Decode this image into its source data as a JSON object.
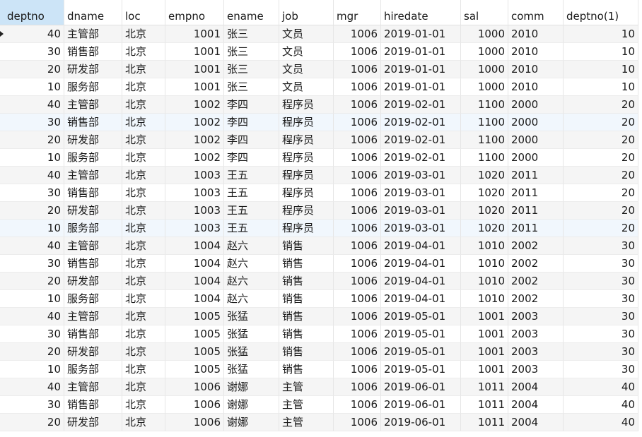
{
  "columns": [
    "deptno",
    "dname",
    "loc",
    "empno",
    "ename",
    "job",
    "mgr",
    "hiredate",
    "sal",
    "comm",
    "deptno(1)"
  ],
  "rows": [
    [
      "40",
      "主管部",
      "北京",
      "1001",
      "张三",
      "文员",
      "1006",
      "2019-01-01",
      "1000",
      "2010",
      "10"
    ],
    [
      "30",
      "销售部",
      "北京",
      "1001",
      "张三",
      "文员",
      "1006",
      "2019-01-01",
      "1000",
      "2010",
      "10"
    ],
    [
      "20",
      "研发部",
      "北京",
      "1001",
      "张三",
      "文员",
      "1006",
      "2019-01-01",
      "1000",
      "2010",
      "10"
    ],
    [
      "10",
      "服务部",
      "北京",
      "1001",
      "张三",
      "文员",
      "1006",
      "2019-01-01",
      "1000",
      "2010",
      "10"
    ],
    [
      "40",
      "主管部",
      "北京",
      "1002",
      "李四",
      "程序员",
      "1006",
      "2019-02-01",
      "1100",
      "2000",
      "20"
    ],
    [
      "30",
      "销售部",
      "北京",
      "1002",
      "李四",
      "程序员",
      "1006",
      "2019-02-01",
      "1100",
      "2000",
      "20"
    ],
    [
      "20",
      "研发部",
      "北京",
      "1002",
      "李四",
      "程序员",
      "1006",
      "2019-02-01",
      "1100",
      "2000",
      "20"
    ],
    [
      "10",
      "服务部",
      "北京",
      "1002",
      "李四",
      "程序员",
      "1006",
      "2019-02-01",
      "1100",
      "2000",
      "20"
    ],
    [
      "40",
      "主管部",
      "北京",
      "1003",
      "王五",
      "程序员",
      "1006",
      "2019-03-01",
      "1020",
      "2011",
      "20"
    ],
    [
      "30",
      "销售部",
      "北京",
      "1003",
      "王五",
      "程序员",
      "1006",
      "2019-03-01",
      "1020",
      "2011",
      "20"
    ],
    [
      "20",
      "研发部",
      "北京",
      "1003",
      "王五",
      "程序员",
      "1006",
      "2019-03-01",
      "1020",
      "2011",
      "20"
    ],
    [
      "10",
      "服务部",
      "北京",
      "1003",
      "王五",
      "程序员",
      "1006",
      "2019-03-01",
      "1020",
      "2011",
      "20"
    ],
    [
      "40",
      "主管部",
      "北京",
      "1004",
      "赵六",
      "销售",
      "1006",
      "2019-04-01",
      "1010",
      "2002",
      "30"
    ],
    [
      "30",
      "销售部",
      "北京",
      "1004",
      "赵六",
      "销售",
      "1006",
      "2019-04-01",
      "1010",
      "2002",
      "30"
    ],
    [
      "20",
      "研发部",
      "北京",
      "1004",
      "赵六",
      "销售",
      "1006",
      "2019-04-01",
      "1010",
      "2002",
      "30"
    ],
    [
      "10",
      "服务部",
      "北京",
      "1004",
      "赵六",
      "销售",
      "1006",
      "2019-04-01",
      "1010",
      "2002",
      "30"
    ],
    [
      "40",
      "主管部",
      "北京",
      "1005",
      "张猛",
      "销售",
      "1006",
      "2019-05-01",
      "1001",
      "2003",
      "30"
    ],
    [
      "30",
      "销售部",
      "北京",
      "1005",
      "张猛",
      "销售",
      "1006",
      "2019-05-01",
      "1001",
      "2003",
      "30"
    ],
    [
      "20",
      "研发部",
      "北京",
      "1005",
      "张猛",
      "销售",
      "1006",
      "2019-05-01",
      "1001",
      "2003",
      "30"
    ],
    [
      "10",
      "服务部",
      "北京",
      "1005",
      "张猛",
      "销售",
      "1006",
      "2019-05-01",
      "1001",
      "2003",
      "30"
    ],
    [
      "40",
      "主管部",
      "北京",
      "1006",
      "谢娜",
      "主管",
      "1006",
      "2019-06-01",
      "1011",
      "2004",
      "40"
    ],
    [
      "30",
      "销售部",
      "北京",
      "1006",
      "谢娜",
      "主管",
      "1006",
      "2019-06-01",
      "1011",
      "2004",
      "40"
    ],
    [
      "20",
      "研发部",
      "北京",
      "1006",
      "谢娜",
      "主管",
      "1006",
      "2019-06-01",
      "1011",
      "2004",
      "40"
    ]
  ],
  "numeric_columns": [
    0,
    3,
    6,
    8,
    10
  ],
  "selected_row": 0,
  "highlighted_rows": [
    5,
    11
  ],
  "selected_header": 0,
  "colors": {
    "header_selected": "#cce4f7",
    "row_alt": "#f5f5f5",
    "row_highlight": "#f1f7fd"
  }
}
